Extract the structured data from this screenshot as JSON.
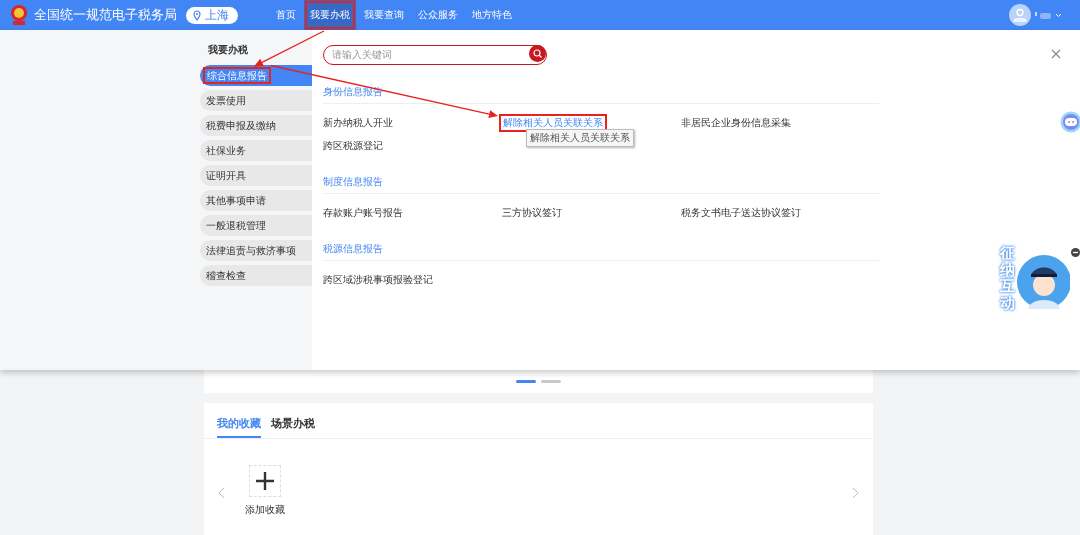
{
  "header": {
    "site_title": "全国统一规范电子税务局",
    "location": "上海",
    "nav": [
      {
        "label": "首页",
        "selected": false,
        "highlighted": false
      },
      {
        "label": "我要办税",
        "selected": true,
        "highlighted": true
      },
      {
        "label": "我要查询",
        "selected": false,
        "highlighted": false
      },
      {
        "label": "公众服务",
        "selected": false,
        "highlighted": false
      },
      {
        "label": "地方特色",
        "selected": false,
        "highlighted": false
      }
    ]
  },
  "menu_panel": {
    "sidebar": {
      "title": "我要办税",
      "items": [
        {
          "label": "综合信息报告",
          "selected": true,
          "highlighted": true
        },
        {
          "label": "发票使用",
          "selected": false,
          "highlighted": false
        },
        {
          "label": "税费申报及缴纳",
          "selected": false,
          "highlighted": false
        },
        {
          "label": "社保业务",
          "selected": false,
          "highlighted": false
        },
        {
          "label": "证明开具",
          "selected": false,
          "highlighted": false
        },
        {
          "label": "其他事项申请",
          "selected": false,
          "highlighted": false
        },
        {
          "label": "一般退税管理",
          "selected": false,
          "highlighted": false
        },
        {
          "label": "法律追责与救济事项",
          "selected": false,
          "highlighted": false
        },
        {
          "label": "稽查检查",
          "selected": false,
          "highlighted": false
        }
      ]
    },
    "search": {
      "placeholder": "请输入关键词"
    },
    "sections": [
      {
        "heading": "身份信息报告",
        "items": [
          {
            "label": "新办纳税人开业",
            "hovered": false,
            "highlighted": false
          },
          {
            "label": "解除相关人员关联关系",
            "hovered": true,
            "highlighted": true,
            "tooltip": "解除相关人员关联关系"
          },
          {
            "label": "非居民企业身份信息采集",
            "hovered": false,
            "highlighted": false
          },
          {
            "label": "跨区税源登记",
            "hovered": false,
            "highlighted": false
          }
        ]
      },
      {
        "heading": "制度信息报告",
        "items": [
          {
            "label": "存款账户账号报告",
            "hovered": false,
            "highlighted": false
          },
          {
            "label": "三方协议签订",
            "hovered": false,
            "highlighted": false
          },
          {
            "label": "税务文书电子送达协议签订",
            "hovered": false,
            "highlighted": false
          }
        ]
      },
      {
        "heading": "税源信息报告",
        "items": [
          {
            "label": "跨区域涉税事项报验登记",
            "hovered": false,
            "highlighted": false
          }
        ]
      }
    ]
  },
  "carousel_dots": [
    {
      "selected": true
    },
    {
      "selected": false
    }
  ],
  "favorites": {
    "tabs": [
      {
        "label": "我的收藏",
        "selected": true
      },
      {
        "label": "场景办税",
        "selected": false
      }
    ],
    "add_label": "添加收藏"
  },
  "assistant_badge": {
    "label": "征纳互动"
  }
}
